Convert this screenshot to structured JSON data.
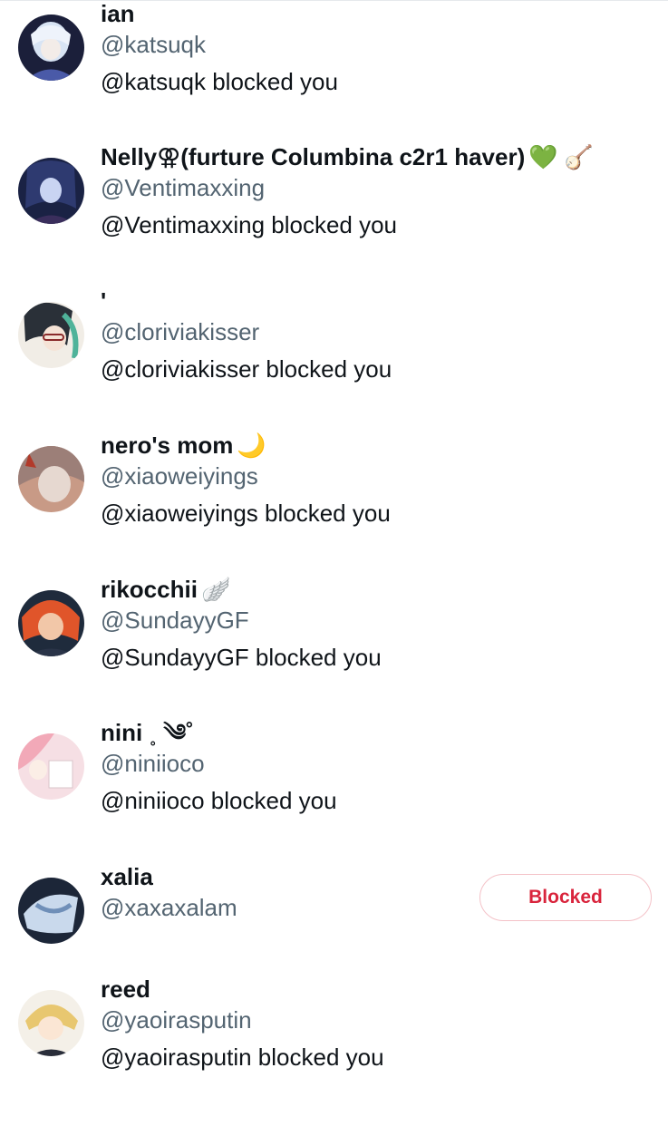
{
  "users": [
    {
      "name": "ian",
      "emoji": "",
      "handle": "@katsuqk",
      "status": "@katsuqk blocked you",
      "avatar_colors": [
        "#1b1f3a",
        "#d8e4f4",
        "#4a5aa8"
      ]
    },
    {
      "name": "Nelly⚢(furture Columbina c2r1 haver)",
      "emoji": "💚 🪕",
      "handle": "@Ventimaxxing",
      "status": "@Ventimaxxing blocked you",
      "avatar_colors": [
        "#1a2244",
        "#2e3a70",
        "#c9d4f2"
      ]
    },
    {
      "name": "'",
      "emoji": "",
      "handle": "@cloriviakisser",
      "status": "@cloriviakisser blocked you",
      "avatar_colors": [
        "#f1ede6",
        "#2a3038",
        "#4fb39a"
      ]
    },
    {
      "name": "nero's mom",
      "emoji": "🌙",
      "handle": "@xiaoweiyings",
      "status": "@xiaoweiyings blocked you",
      "avatar_colors": [
        "#c89a86",
        "#e6d8d0",
        "#b23a2a"
      ]
    },
    {
      "name": "rikocchii",
      "emoji": "🪽",
      "handle": "@SundayyGF",
      "status": "@SundayyGF blocked you",
      "avatar_colors": [
        "#1f2b3c",
        "#e0552a",
        "#f2c7a8"
      ]
    },
    {
      "name": "nini ˳ ༄˚",
      "emoji": "",
      "handle": "@niniioco",
      "status": "@niniioco blocked you",
      "avatar_colors": [
        "#f6dfe4",
        "#f2a9b8",
        "#ffffff"
      ]
    },
    {
      "name": "xalia",
      "emoji": "",
      "handle": "@xaxaxalam",
      "status": "",
      "button_label": "Blocked",
      "avatar_colors": [
        "#1c2638",
        "#c9d9ec",
        "#6f8fb8"
      ]
    },
    {
      "name": "reed",
      "emoji": "",
      "handle": "@yaoirasputin",
      "status": "@yaoirasputin blocked you",
      "avatar_colors": [
        "#f4f0e8",
        "#e8c770",
        "#2a2e3a"
      ]
    }
  ],
  "colors": {
    "name": "#0f1419",
    "handle": "#536471",
    "blocked_text": "#d9243c",
    "blocked_border": "#f4c2c8"
  }
}
